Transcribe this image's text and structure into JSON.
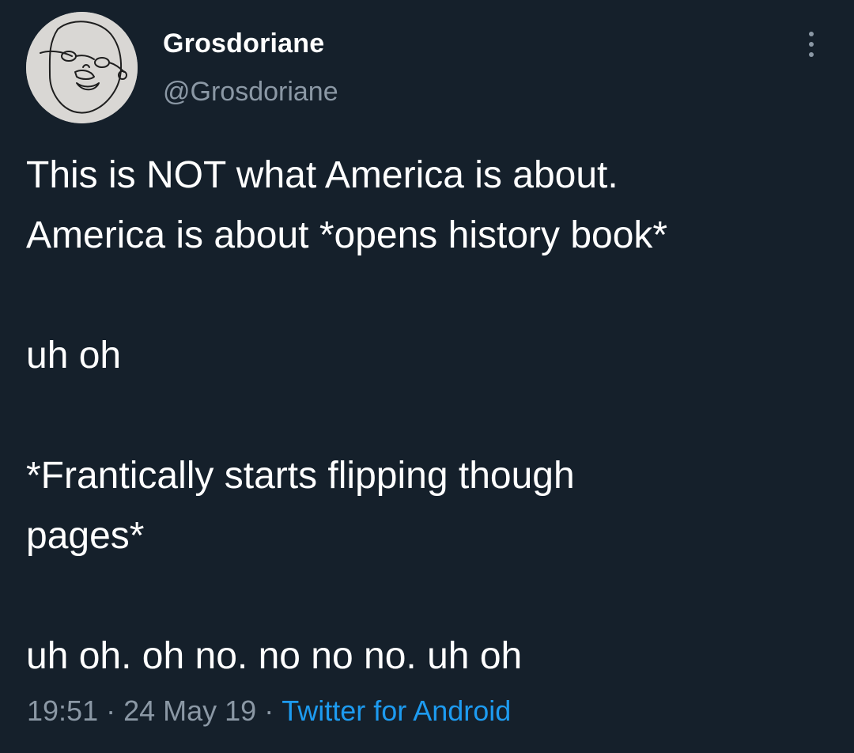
{
  "author": {
    "display_name": "Grosdoriane",
    "handle": "@Grosdoriane",
    "avatar_icon": "sketch-face-avatar"
  },
  "tweet": {
    "lines": [
      "This is NOT what America is about.",
      "America is about *opens history book*",
      "",
      "uh oh",
      "",
      "*Frantically starts flipping though",
      "pages*",
      "",
      "uh oh. oh no. no no no. uh oh"
    ]
  },
  "meta": {
    "time": "19:51",
    "date": "24 May 19",
    "separator": "·",
    "source": "Twitter for Android"
  },
  "icons": {
    "more": "more-vertical-icon"
  },
  "colors": {
    "background": "#15202b",
    "primary_text": "#ffffff",
    "secondary_text": "#8b98a5",
    "link": "#1d9bf0"
  }
}
